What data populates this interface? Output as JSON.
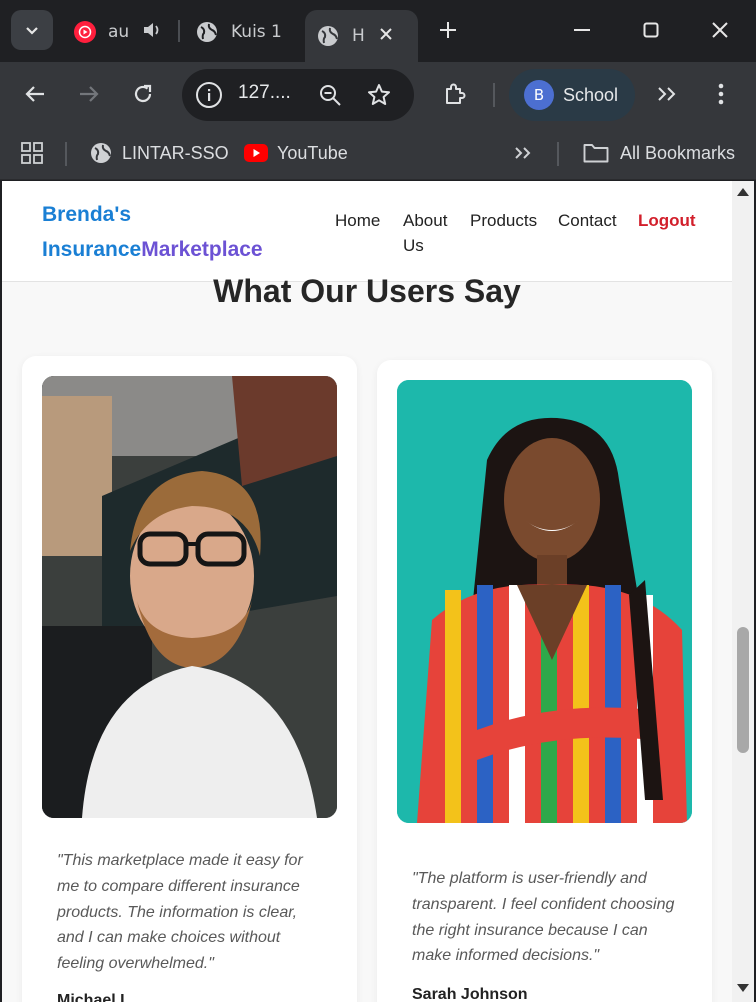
{
  "browser": {
    "tabs": [
      {
        "label": "au",
        "icon": "youtube-music-icon",
        "audio": true
      },
      {
        "label": "Kuis 1",
        "icon": "globe-icon"
      },
      {
        "label": "H",
        "icon": "globe-icon",
        "active": true
      }
    ],
    "address": "127....",
    "profile": {
      "initial": "B",
      "label": "School"
    },
    "bookmarks": [
      {
        "label": "LINTAR-SSO",
        "icon": "globe-icon"
      },
      {
        "label": "YouTube",
        "icon": "youtube-icon"
      }
    ],
    "all_bookmarks_label": "All Bookmarks"
  },
  "site": {
    "brand": {
      "line1": "Brenda's",
      "part_a": "Insurance",
      "part_b": "Marketplace"
    },
    "nav": [
      {
        "label": "Home"
      },
      {
        "label": "About Us"
      },
      {
        "label": "Products"
      },
      {
        "label": "Contact"
      },
      {
        "label": "Logout"
      }
    ],
    "colors": {
      "brand_blue": "#1a7fd4",
      "brand_purple": "#6c52d4",
      "logout_red": "#d21f2b"
    }
  },
  "testimonials": {
    "title": "What Our Users Say",
    "items": [
      {
        "photo": "man-with-glasses-photo",
        "quote": "\"This marketplace made it easy for me to compare different insurance products. The information is clear, and I can make choices without feeling overwhelmed.\"",
        "author": "Michael L."
      },
      {
        "photo": "woman-striped-dress-photo",
        "quote": "\"The platform is user-friendly and transparent. I feel confident choosing the right insurance because I can make informed decisions.\"",
        "author": "Sarah Johnson"
      }
    ]
  }
}
